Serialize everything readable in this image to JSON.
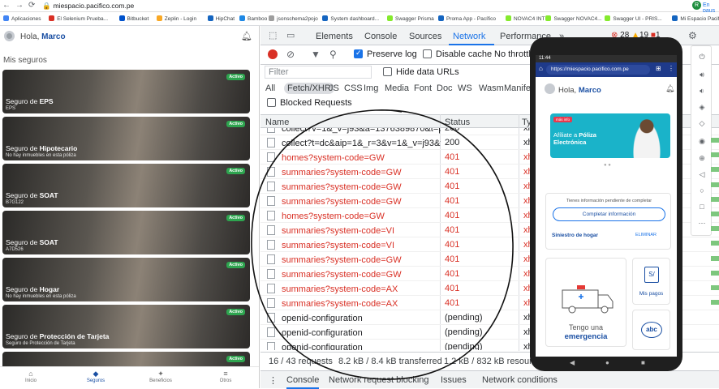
{
  "browser": {
    "url": "miespacio.pacifico.com.pe",
    "profile_initial": "R",
    "profile_status": "En paus",
    "bookmarks": [
      {
        "label": "Aplicaciones",
        "color": "#4285f4"
      },
      {
        "label": "El Selenium Prueba...",
        "color": "#d93025"
      },
      {
        "label": "Bitbucket",
        "color": "#0052cc"
      },
      {
        "label": "Zeplin - Login",
        "color": "#f9a825"
      },
      {
        "label": "HipChat",
        "color": "#1565c0"
      },
      {
        "label": "Bamboo",
        "color": "#1e88e5"
      },
      {
        "label": "jsonschema2pojo",
        "color": "#9e9e9e"
      },
      {
        "label": "System dashboard...",
        "color": "#1565c0"
      },
      {
        "label": "Swagger Prisma",
        "color": "#85ea2d"
      },
      {
        "label": "Proma App - Pacífico",
        "color": "#1565c0"
      },
      {
        "label": "NOVAC4 INT",
        "color": "#85ea2d"
      },
      {
        "label": "Swagger NOVAC4...",
        "color": "#85ea2d"
      },
      {
        "label": "Swagger UI - PRIS...",
        "color": "#85ea2d"
      },
      {
        "label": "Mi Espacio Pacifico",
        "color": "#1565c0"
      },
      {
        "label": "Lista",
        "color": "#9e9e9e"
      }
    ]
  },
  "app": {
    "greeting": "Hola,",
    "user_name": "Marco",
    "section_title": "Mis seguros",
    "cards": [
      {
        "pre": "Seguro de ",
        "bold": "EPS",
        "sub": "EPS",
        "badge": "Activo"
      },
      {
        "pre": "Seguro de ",
        "bold": "Hipotecario",
        "sub": "No hay inmuebles en esta póliza",
        "badge": "Activo"
      },
      {
        "pre": "Seguro de ",
        "bold": "SOAT",
        "sub": "B7G122",
        "badge": "Activo"
      },
      {
        "pre": "Seguro de ",
        "bold": "SOAT",
        "sub": "A7D526",
        "badge": "Activo"
      },
      {
        "pre": "Seguro de ",
        "bold": "Hogar",
        "sub": "No hay inmuebles en esta póliza",
        "badge": "Activo"
      },
      {
        "pre": "Seguro de ",
        "bold": "Protección de Tarjeta",
        "sub": "Seguro de Protección de Tarjeta",
        "badge": "Activo"
      },
      {
        "pre": "",
        "bold": "",
        "sub": "",
        "badge": "Activo"
      }
    ],
    "tabs": [
      {
        "label": "Inicio",
        "icon": "⌂"
      },
      {
        "label": "Seguros",
        "icon": "◆"
      },
      {
        "label": "Beneficios",
        "icon": "✦"
      },
      {
        "label": "Otros",
        "icon": "≡"
      }
    ]
  },
  "devtools": {
    "tabs": [
      "Elements",
      "Console",
      "Sources",
      "Network",
      "Performance",
      "»"
    ],
    "active_tab": "Network",
    "errors": "28",
    "warnings": "19",
    "issues": "1",
    "preserve_log": "Preserve log",
    "disable_cache": "Disable cache",
    "throttling": "No throttlin",
    "filter_placeholder": "Filter",
    "hide_data_urls": "Hide data URLs",
    "type_filters": [
      "All",
      "Fetch/XHR",
      "JS",
      "CSS",
      "Img",
      "Media",
      "Font",
      "Doc",
      "WS",
      "Wasm",
      "Manife"
    ],
    "active_filter": "Fetch/XHR",
    "blocked_requests": "Blocked Requests",
    "columns": {
      "name": "Name",
      "status": "Status",
      "type": "Ty"
    },
    "rows": [
      {
        "name": "collect?v=1&_v=j93&a=1376389870&t=pa...",
        "status": "200",
        "type": "xh",
        "error": false
      },
      {
        "name": "collect?t=dc&aip=1&_r=3&v=1&_v=j93&t...",
        "status": "200",
        "type": "xh",
        "error": false
      },
      {
        "name": "homes?system-code=GW",
        "status": "401",
        "type": "xh",
        "error": true
      },
      {
        "name": "summaries?system-code=GW",
        "status": "401",
        "type": "xh",
        "error": true
      },
      {
        "name": "summaries?system-code=GW",
        "status": "401",
        "type": "xh",
        "error": true
      },
      {
        "name": "summaries?system-code=GW",
        "status": "401",
        "type": "xh",
        "error": true
      },
      {
        "name": "homes?system-code=GW",
        "status": "401",
        "type": "xh",
        "error": true
      },
      {
        "name": "summaries?system-code=VI",
        "status": "401",
        "type": "xh",
        "error": true
      },
      {
        "name": "summaries?system-code=VI",
        "status": "401",
        "type": "xh",
        "error": true
      },
      {
        "name": "summaries?system-code=GW",
        "status": "401",
        "type": "xh",
        "error": true
      },
      {
        "name": "summaries?system-code=GW",
        "status": "401",
        "type": "xh",
        "error": true
      },
      {
        "name": "summaries?system-code=AX",
        "status": "401",
        "type": "xh",
        "error": true
      },
      {
        "name": "summaries?system-code=AX",
        "status": "401",
        "type": "xh",
        "error": true
      },
      {
        "name": "openid-configuration",
        "status": "(pending)",
        "type": "xh",
        "error": false
      },
      {
        "name": "openid-configuration",
        "status": "(pending)",
        "type": "xh",
        "error": false
      },
      {
        "name": "openid-configuration",
        "status": "(pending)",
        "type": "xh",
        "error": false
      }
    ],
    "summary_requests": "16 / 43 requests",
    "summary_transferred": "8.2 kB / 8.4 kB transferred",
    "summary_resources": "1.2 kB / 832 kB resource",
    "drawer_tabs": [
      "Console",
      "Network request blocking",
      "Issues",
      "Network conditions"
    ]
  },
  "phone": {
    "time": "11:44",
    "url": "https://miespacio.pacifico.com.pe",
    "greeting": "Hola,",
    "user_name": "Marco",
    "banner_tag": "más info",
    "banner_text_pre": "Afíliate a ",
    "banner_text_bold": "Póliza Electrónica",
    "pending_title": "Tienes información pendiente de completar",
    "pending_button": "Completar información",
    "pending_item": "Siniestro de hogar",
    "pending_action": "ELIMINAR",
    "pay_label": "Mis pagos",
    "emergency_pre": "Tengo una",
    "emergency_bold": "emergencia"
  }
}
